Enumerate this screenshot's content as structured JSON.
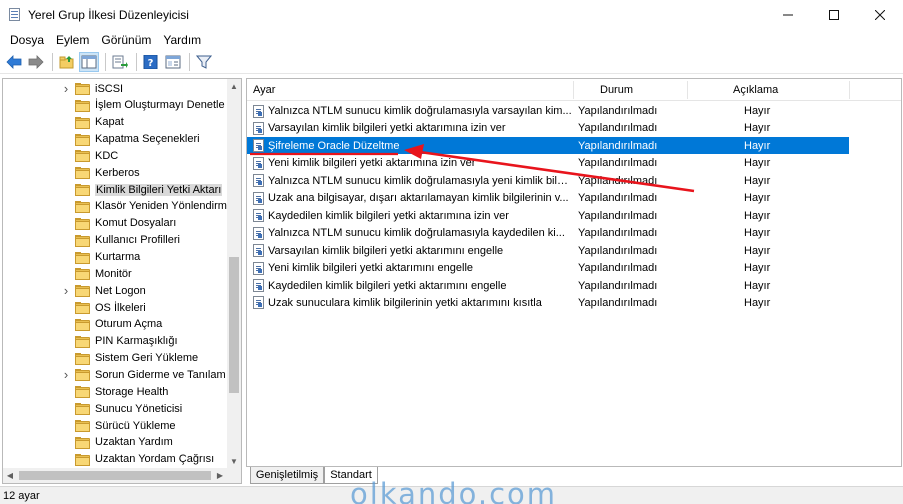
{
  "window": {
    "title": "Yerel Grup İlkesi Düzenleyicisi",
    "controls": {
      "minimize": "—",
      "maximize": "☐",
      "close": "✕"
    }
  },
  "menu": [
    "Dosya",
    "Eylem",
    "Görünüm",
    "Yardım"
  ],
  "toolbar": {
    "buttons": [
      "back-arrow-icon",
      "forward-arrow-icon",
      "folder-up-icon",
      "show-hide-tree-icon",
      "export-list-icon",
      "help-icon",
      "view-icon",
      "filter-icon"
    ]
  },
  "tree": {
    "items": [
      {
        "label": "iSCSI",
        "expandable": true
      },
      {
        "label": "İşlem Oluşturmayı Denetle",
        "expandable": false
      },
      {
        "label": "Kapat",
        "expandable": false
      },
      {
        "label": "Kapatma Seçenekleri",
        "expandable": false
      },
      {
        "label": "KDC",
        "expandable": false
      },
      {
        "label": "Kerberos",
        "expandable": false
      },
      {
        "label": "Kimlik Bilgileri Yetki Aktarı",
        "expandable": false,
        "selected": true
      },
      {
        "label": "Klasör Yeniden Yönlendirm",
        "expandable": false
      },
      {
        "label": "Komut Dosyaları",
        "expandable": false
      },
      {
        "label": "Kullanıcı Profilleri",
        "expandable": false
      },
      {
        "label": "Kurtarma",
        "expandable": false
      },
      {
        "label": "Monitör",
        "expandable": false
      },
      {
        "label": "Net Logon",
        "expandable": true
      },
      {
        "label": "OS İlkeleri",
        "expandable": false
      },
      {
        "label": "Oturum Açma",
        "expandable": false
      },
      {
        "label": "PIN Karmaşıklığı",
        "expandable": false
      },
      {
        "label": "Sistem Geri Yükleme",
        "expandable": false
      },
      {
        "label": "Sorun Giderme ve Tanılam",
        "expandable": true
      },
      {
        "label": "Storage Health",
        "expandable": false
      },
      {
        "label": "Sunucu Yöneticisi",
        "expandable": false
      },
      {
        "label": "Sürücü Yükleme",
        "expandable": false
      },
      {
        "label": "Uzaktan Yardım",
        "expandable": false
      },
      {
        "label": "Uzaktan Yordam Çağrısı",
        "expandable": false
      }
    ]
  },
  "list": {
    "columns": {
      "name": "Ayar",
      "status": "Durum",
      "description": "Açıklama"
    },
    "rows": [
      {
        "name": "Yalnızca NTLM sunucu kimlik doğrulamasıyla varsayılan kim...",
        "status": "Yapılandırılmadı",
        "description": "Hayır"
      },
      {
        "name": "Varsayılan kimlik bilgileri yetki aktarımına izin ver",
        "status": "Yapılandırılmadı",
        "description": "Hayır"
      },
      {
        "name": "Şifreleme Oracle Düzeltme",
        "status": "Yapılandırılmadı",
        "description": "Hayır",
        "selected": true
      },
      {
        "name": "Yeni kimlik bilgileri yetki aktarımına izin ver",
        "status": "Yapılandırılmadı",
        "description": "Hayır"
      },
      {
        "name": "Yalnızca NTLM sunucu kimlik doğrulamasıyla yeni kimlik bilgil...",
        "status": "Yapılandırılmadı",
        "description": "Hayır"
      },
      {
        "name": "Uzak ana bilgisayar, dışarı aktarılamayan kimlik bilgilerinin v...",
        "status": "Yapılandırılmadı",
        "description": "Hayır"
      },
      {
        "name": "Kaydedilen kimlik bilgileri yetki aktarımına izin ver",
        "status": "Yapılandırılmadı",
        "description": "Hayır"
      },
      {
        "name": "Yalnızca NTLM sunucu kimlik doğrulamasıyla kaydedilen ki...",
        "status": "Yapılandırılmadı",
        "description": "Hayır"
      },
      {
        "name": "Varsayılan kimlik bilgileri yetki aktarımını engelle",
        "status": "Yapılandırılmadı",
        "description": "Hayır"
      },
      {
        "name": "Yeni kimlik bilgileri yetki aktarımını engelle",
        "status": "Yapılandırılmadı",
        "description": "Hayır"
      },
      {
        "name": "Kaydedilen kimlik bilgileri yetki aktarımını engelle",
        "status": "Yapılandırılmadı",
        "description": "Hayır"
      },
      {
        "name": "Uzak sunuculara kimlik bilgilerinin yetki aktarımını kısıtla",
        "status": "Yapılandırılmadı",
        "description": "Hayır"
      }
    ]
  },
  "tabs": [
    {
      "label": "Genişletilmiş",
      "active": false
    },
    {
      "label": "Standart",
      "active": true
    }
  ],
  "statusbar": {
    "text": "12 ayar"
  },
  "watermark": "olkando.com",
  "colors": {
    "selection": "#0078d7",
    "annotation_arrow": "#e8141c",
    "watermark": "#5a9bd5",
    "folder": "#f8d775"
  }
}
